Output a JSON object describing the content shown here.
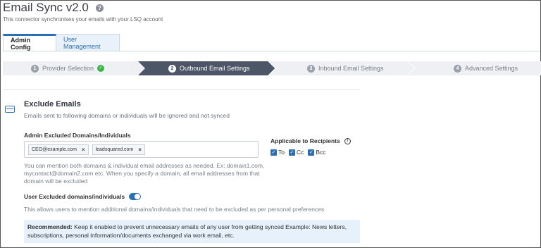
{
  "app": {
    "title": "Email Sync v2.0",
    "subtitle": "This connector synchronises your emails with your LSQ account"
  },
  "tabs": [
    {
      "label": "Admin Config",
      "active": true
    },
    {
      "label": "User Management",
      "active": false
    }
  ],
  "stepper": [
    {
      "num": "1",
      "label": "Provider Selection",
      "state": "done"
    },
    {
      "num": "2",
      "label": "Outbound Email Settings",
      "state": "active"
    },
    {
      "num": "3",
      "label": "Inbound Email Settings",
      "state": "upcoming"
    },
    {
      "num": "4",
      "label": "Advanced Settings",
      "state": "upcoming"
    }
  ],
  "exclude": {
    "title": "Exclude Emails",
    "description": "Emails sent to following domains or individuals will be ignored and not synced",
    "admin_label": "Admin Excluded Domains/Individuals",
    "tags": [
      "CEO@example.com",
      "leadsquared.com"
    ],
    "help_text": "You can mention both domains & individual email addresses as needed. Ex: domain1.com, mycontact@domain2.com etc. When you specify a domain, all email addresses from that domain will be excluded",
    "user_toggle_label": "User Excluded domains/individuals",
    "user_toggle_on": true,
    "user_toggle_desc": "This allows users to mention additional domains/individuals that need to be excluded as per personal preferences",
    "recommended_label": "Recommended:",
    "recommended_text": "Keep it enabled to prevent unnecessary emails of any user from getting synced Example: News letters, subscriptions, personal information/documents exchanged via work email, etc."
  },
  "recipients": {
    "label": "Applicable to Recipients",
    "options": [
      {
        "label": "To",
        "checked": true
      },
      {
        "label": "Cc",
        "checked": true
      },
      {
        "label": "Bcc",
        "checked": true
      }
    ]
  },
  "colors": {
    "accent": "#2d6fb4",
    "step_active": "#4d5666",
    "success": "#3bb54a",
    "recommend_bg": "#e7f1fb"
  }
}
